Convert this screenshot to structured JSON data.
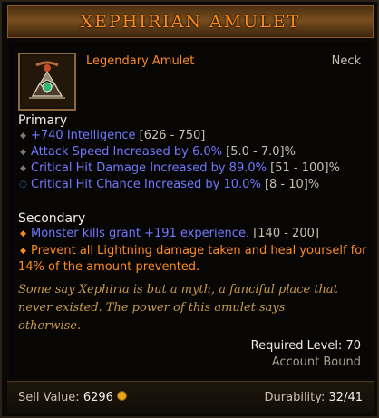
{
  "item": {
    "name": "XEPHIRIAN AMULET",
    "type": "Legendary Amulet",
    "slot": "Neck",
    "icon": "amulet-icon"
  },
  "primary": {
    "title": "Primary",
    "stats": [
      {
        "text": "+740 Intelligence",
        "range": "[626 - 750]",
        "bullet": "diamond-icon"
      },
      {
        "text": "Attack Speed Increased by 6.0%",
        "range": "[5.0 - 7.0]%",
        "bullet": "diamond-icon"
      },
      {
        "text": "Critical Hit Damage Increased by 89.0%",
        "range": "[51 - 100]%",
        "bullet": "diamond-icon"
      },
      {
        "text": "Critical Hit Chance Increased by 10.0%",
        "range": "[8 - 10]%",
        "bullet": "enchant-ring-icon"
      }
    ]
  },
  "secondary": {
    "title": "Secondary",
    "stats": [
      {
        "text": "Monster kills grant +191 experience.",
        "range": "[140 - 200]"
      },
      {
        "line1": "Prevent all Lightning damage taken and heal yourself for",
        "line2": "14% of the amount prevented."
      }
    ]
  },
  "flavor": {
    "line1": "Some say Xephiria is but a myth, a fanciful place that",
    "line2": "never existed. The power of this amulet says",
    "line3": "otherwise."
  },
  "requirements": {
    "level": "Required Level: 70",
    "bound": "Account Bound"
  },
  "footer": {
    "sell_label": "Sell Value:",
    "sell_value": "6296",
    "durability_label": "Durability:",
    "durability_value": "32/41"
  },
  "colors": {
    "legendary": "#ff8a1e",
    "magic_stat": "#6f79ff",
    "range": "#c9c0b0",
    "flavor": "#c89b49",
    "header_bg": "#7a4f1e"
  }
}
